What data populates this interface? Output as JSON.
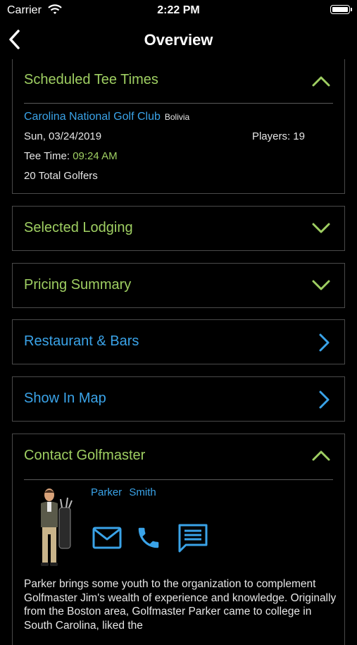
{
  "status_bar": {
    "carrier": "Carrier",
    "time": "2:22 PM"
  },
  "nav": {
    "title": "Overview"
  },
  "tee_times": {
    "title": "Scheduled Tee Times",
    "club": "Carolina National Golf Club",
    "country": "Bolivia",
    "date": "Sun, 03/24/2019",
    "players": "Players: 19",
    "tee_time_label": "Tee Time:",
    "tee_time_value": "09:24 AM",
    "total": "20 Total Golfers"
  },
  "sections": {
    "lodging": "Selected Lodging",
    "pricing": "Pricing Summary",
    "restaurants": "Restaurant & Bars",
    "map": "Show In Map",
    "contact": "Contact Golfmaster"
  },
  "golfmaster": {
    "first_name": "Parker",
    "last_name": "Smith",
    "bio": "Parker brings some youth to the organization to complement Golfmaster Jim's wealth of experience and knowledge. Originally from the Boston area, Golfmaster Parker came to college in South Carolina, liked the"
  },
  "colors": {
    "accent_green": "#9fcf62",
    "accent_blue": "#3aa3e8",
    "border": "#4a4a4a"
  }
}
